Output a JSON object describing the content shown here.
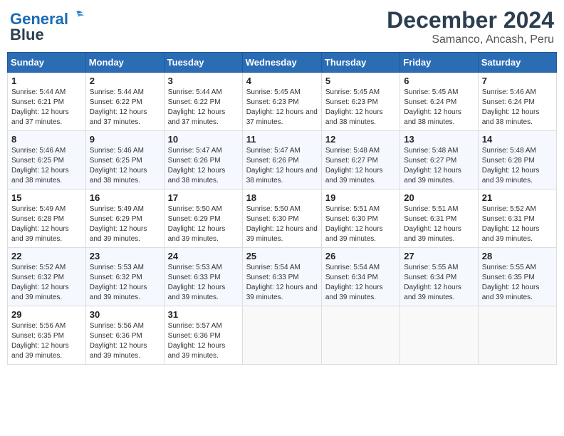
{
  "header": {
    "logo_line1": "General",
    "logo_line2": "Blue",
    "title": "December 2024",
    "subtitle": "Samanco, Ancash, Peru"
  },
  "calendar": {
    "days_of_week": [
      "Sunday",
      "Monday",
      "Tuesday",
      "Wednesday",
      "Thursday",
      "Friday",
      "Saturday"
    ],
    "weeks": [
      [
        {
          "day": "",
          "empty": true
        },
        {
          "day": "",
          "empty": true
        },
        {
          "day": "",
          "empty": true
        },
        {
          "day": "",
          "empty": true
        },
        {
          "day": "",
          "empty": true
        },
        {
          "day": "",
          "empty": true
        },
        {
          "day": "",
          "empty": true
        }
      ],
      [
        {
          "day": "1",
          "sunrise": "5:44 AM",
          "sunset": "6:21 PM",
          "daylight": "12 hours and 37 minutes."
        },
        {
          "day": "2",
          "sunrise": "5:44 AM",
          "sunset": "6:22 PM",
          "daylight": "12 hours and 37 minutes."
        },
        {
          "day": "3",
          "sunrise": "5:44 AM",
          "sunset": "6:22 PM",
          "daylight": "12 hours and 37 minutes."
        },
        {
          "day": "4",
          "sunrise": "5:45 AM",
          "sunset": "6:23 PM",
          "daylight": "12 hours and 37 minutes."
        },
        {
          "day": "5",
          "sunrise": "5:45 AM",
          "sunset": "6:23 PM",
          "daylight": "12 hours and 38 minutes."
        },
        {
          "day": "6",
          "sunrise": "5:45 AM",
          "sunset": "6:24 PM",
          "daylight": "12 hours and 38 minutes."
        },
        {
          "day": "7",
          "sunrise": "5:46 AM",
          "sunset": "6:24 PM",
          "daylight": "12 hours and 38 minutes."
        }
      ],
      [
        {
          "day": "8",
          "sunrise": "5:46 AM",
          "sunset": "6:25 PM",
          "daylight": "12 hours and 38 minutes."
        },
        {
          "day": "9",
          "sunrise": "5:46 AM",
          "sunset": "6:25 PM",
          "daylight": "12 hours and 38 minutes."
        },
        {
          "day": "10",
          "sunrise": "5:47 AM",
          "sunset": "6:26 PM",
          "daylight": "12 hours and 38 minutes."
        },
        {
          "day": "11",
          "sunrise": "5:47 AM",
          "sunset": "6:26 PM",
          "daylight": "12 hours and 38 minutes."
        },
        {
          "day": "12",
          "sunrise": "5:48 AM",
          "sunset": "6:27 PM",
          "daylight": "12 hours and 39 minutes."
        },
        {
          "day": "13",
          "sunrise": "5:48 AM",
          "sunset": "6:27 PM",
          "daylight": "12 hours and 39 minutes."
        },
        {
          "day": "14",
          "sunrise": "5:48 AM",
          "sunset": "6:28 PM",
          "daylight": "12 hours and 39 minutes."
        }
      ],
      [
        {
          "day": "15",
          "sunrise": "5:49 AM",
          "sunset": "6:28 PM",
          "daylight": "12 hours and 39 minutes."
        },
        {
          "day": "16",
          "sunrise": "5:49 AM",
          "sunset": "6:29 PM",
          "daylight": "12 hours and 39 minutes."
        },
        {
          "day": "17",
          "sunrise": "5:50 AM",
          "sunset": "6:29 PM",
          "daylight": "12 hours and 39 minutes."
        },
        {
          "day": "18",
          "sunrise": "5:50 AM",
          "sunset": "6:30 PM",
          "daylight": "12 hours and 39 minutes."
        },
        {
          "day": "19",
          "sunrise": "5:51 AM",
          "sunset": "6:30 PM",
          "daylight": "12 hours and 39 minutes."
        },
        {
          "day": "20",
          "sunrise": "5:51 AM",
          "sunset": "6:31 PM",
          "daylight": "12 hours and 39 minutes."
        },
        {
          "day": "21",
          "sunrise": "5:52 AM",
          "sunset": "6:31 PM",
          "daylight": "12 hours and 39 minutes."
        }
      ],
      [
        {
          "day": "22",
          "sunrise": "5:52 AM",
          "sunset": "6:32 PM",
          "daylight": "12 hours and 39 minutes."
        },
        {
          "day": "23",
          "sunrise": "5:53 AM",
          "sunset": "6:32 PM",
          "daylight": "12 hours and 39 minutes."
        },
        {
          "day": "24",
          "sunrise": "5:53 AM",
          "sunset": "6:33 PM",
          "daylight": "12 hours and 39 minutes."
        },
        {
          "day": "25",
          "sunrise": "5:54 AM",
          "sunset": "6:33 PM",
          "daylight": "12 hours and 39 minutes."
        },
        {
          "day": "26",
          "sunrise": "5:54 AM",
          "sunset": "6:34 PM",
          "daylight": "12 hours and 39 minutes."
        },
        {
          "day": "27",
          "sunrise": "5:55 AM",
          "sunset": "6:34 PM",
          "daylight": "12 hours and 39 minutes."
        },
        {
          "day": "28",
          "sunrise": "5:55 AM",
          "sunset": "6:35 PM",
          "daylight": "12 hours and 39 minutes."
        }
      ],
      [
        {
          "day": "29",
          "sunrise": "5:56 AM",
          "sunset": "6:35 PM",
          "daylight": "12 hours and 39 minutes."
        },
        {
          "day": "30",
          "sunrise": "5:56 AM",
          "sunset": "6:36 PM",
          "daylight": "12 hours and 39 minutes."
        },
        {
          "day": "31",
          "sunrise": "5:57 AM",
          "sunset": "6:36 PM",
          "daylight": "12 hours and 39 minutes."
        },
        {
          "day": "",
          "empty": true
        },
        {
          "day": "",
          "empty": true
        },
        {
          "day": "",
          "empty": true
        },
        {
          "day": "",
          "empty": true
        }
      ]
    ]
  }
}
